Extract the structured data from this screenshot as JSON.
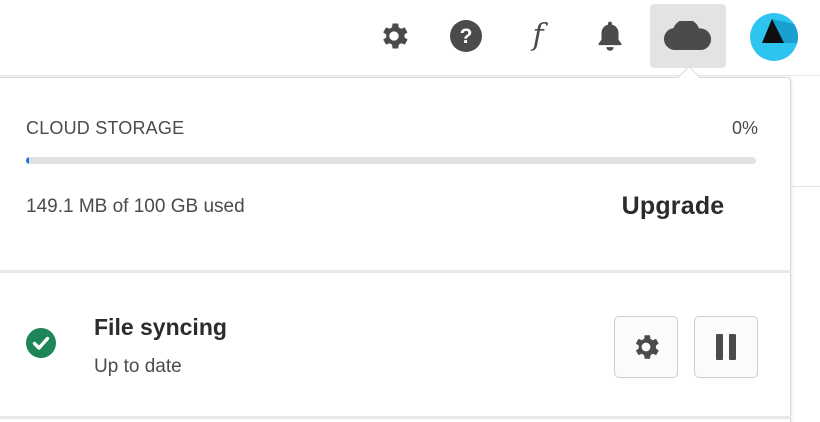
{
  "topbar": {
    "icons": {
      "settings": "gear-icon",
      "help": "help-icon",
      "fonts": "fonts-icon",
      "notifications": "bell-icon",
      "cloud": "cloud-icon"
    },
    "fonts_glyph": "f",
    "help_glyph": "?"
  },
  "storage": {
    "title": "CLOUD STORAGE",
    "percent_label": "0%",
    "used_fraction": 0.0015,
    "used_text": "149.1 MB of 100 GB used",
    "upgrade_label": "Upgrade"
  },
  "sync": {
    "title": "File syncing",
    "status": "Up to date",
    "settings_icon": "gear-icon",
    "pause_icon": "pause-icon"
  },
  "colors": {
    "accent": "#1473e6",
    "success": "#1d8558",
    "icon": "#4b4b4b",
    "avatar": "#2dc4f0"
  }
}
